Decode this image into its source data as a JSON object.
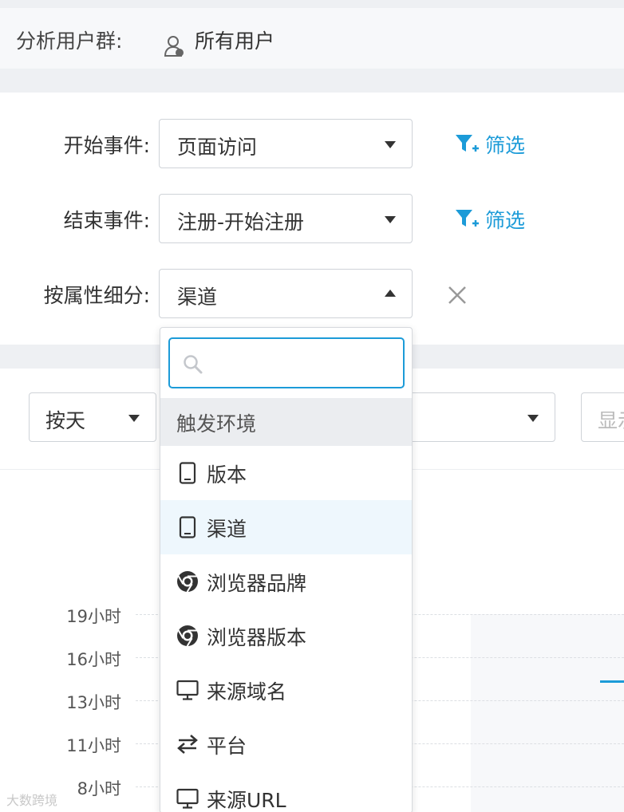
{
  "user_group": {
    "label": "分析用户群:",
    "value": "所有用户"
  },
  "form": {
    "start_event": {
      "label": "开始事件:",
      "value": "页面访问",
      "filter": "筛选"
    },
    "end_event": {
      "label": "结束事件:",
      "value": "注册-开始注册",
      "filter": "筛选"
    },
    "breakdown": {
      "label": "按属性细分:",
      "value": "渠道"
    }
  },
  "toolbar": {
    "granularity": "按天",
    "display_placeholder": "显示"
  },
  "dropdown": {
    "search_placeholder": "",
    "group": "触发环境",
    "items": [
      {
        "label": "版本",
        "icon": "tablet-icon"
      },
      {
        "label": "渠道",
        "icon": "tablet-icon",
        "selected": true
      },
      {
        "label": "浏览器品牌",
        "icon": "chrome-icon"
      },
      {
        "label": "浏览器版本",
        "icon": "chrome-icon"
      },
      {
        "label": "来源域名",
        "icon": "monitor-icon"
      },
      {
        "label": "平台",
        "icon": "swap-arrows-icon"
      },
      {
        "label": "来源URL",
        "icon": "monitor-icon"
      }
    ]
  },
  "chart": {
    "y_ticks": [
      "19小时",
      "16小时",
      "13小时",
      "11小时",
      "8小时"
    ]
  },
  "watermark": "大数跨境",
  "colors": {
    "accent": "#1c9bd8",
    "border": "#cfd3d8",
    "band": "#eef0f3"
  }
}
